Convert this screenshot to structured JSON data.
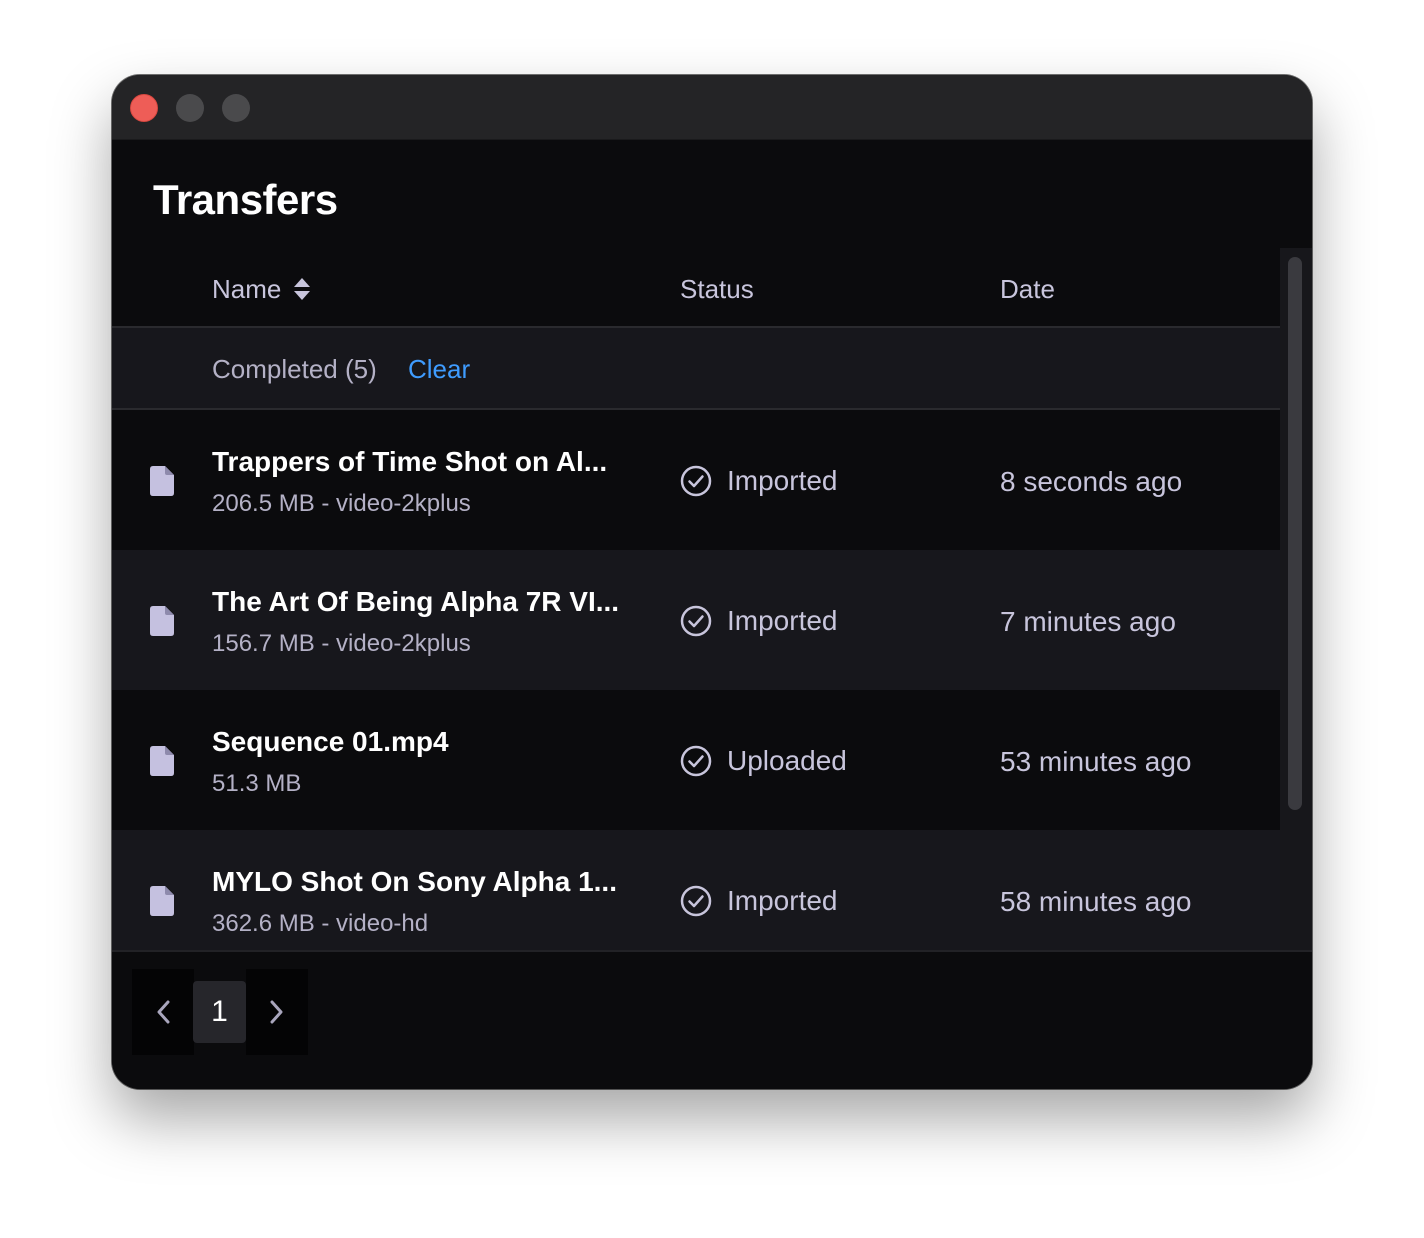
{
  "window": {
    "title": "Transfers"
  },
  "table": {
    "columns": {
      "name": "Name",
      "status": "Status",
      "date": "Date"
    },
    "group": {
      "label": "Completed (5)",
      "clear_label": "Clear"
    },
    "rows": [
      {
        "icon": "file-icon",
        "title": "Trappers of Time Shot on Al...",
        "subtitle": "206.5 MB - video-2kplus",
        "status_icon": "check-circle-icon",
        "status": "Imported",
        "date": "8 seconds ago"
      },
      {
        "icon": "file-icon",
        "title": "The Art Of Being Alpha 7R VI...",
        "subtitle": "156.7 MB - video-2kplus",
        "status_icon": "check-circle-icon",
        "status": "Imported",
        "date": "7 minutes ago"
      },
      {
        "icon": "file-icon",
        "title": "Sequence 01.mp4",
        "subtitle": "51.3 MB",
        "status_icon": "check-circle-icon",
        "status": "Uploaded",
        "date": "53 minutes ago"
      },
      {
        "icon": "file-icon",
        "title": "MYLO Shot On Sony Alpha 1...",
        "subtitle": "362.6 MB - video-hd",
        "status_icon": "check-circle-icon",
        "status": "Imported",
        "date": "58 minutes ago"
      }
    ]
  },
  "pagination": {
    "current_page": "1",
    "prev_icon": "chevron-left-icon",
    "next_icon": "chevron-right-icon"
  },
  "colors": {
    "window_bg": "#0b0b0d",
    "row_alt_bg": "#17171c",
    "accent": "#3f9cff",
    "text_primary": "#ffffff",
    "text_secondary": "#c8c5dc",
    "icon_fill": "#c5c1e0",
    "close_button": "#ee5d57"
  }
}
